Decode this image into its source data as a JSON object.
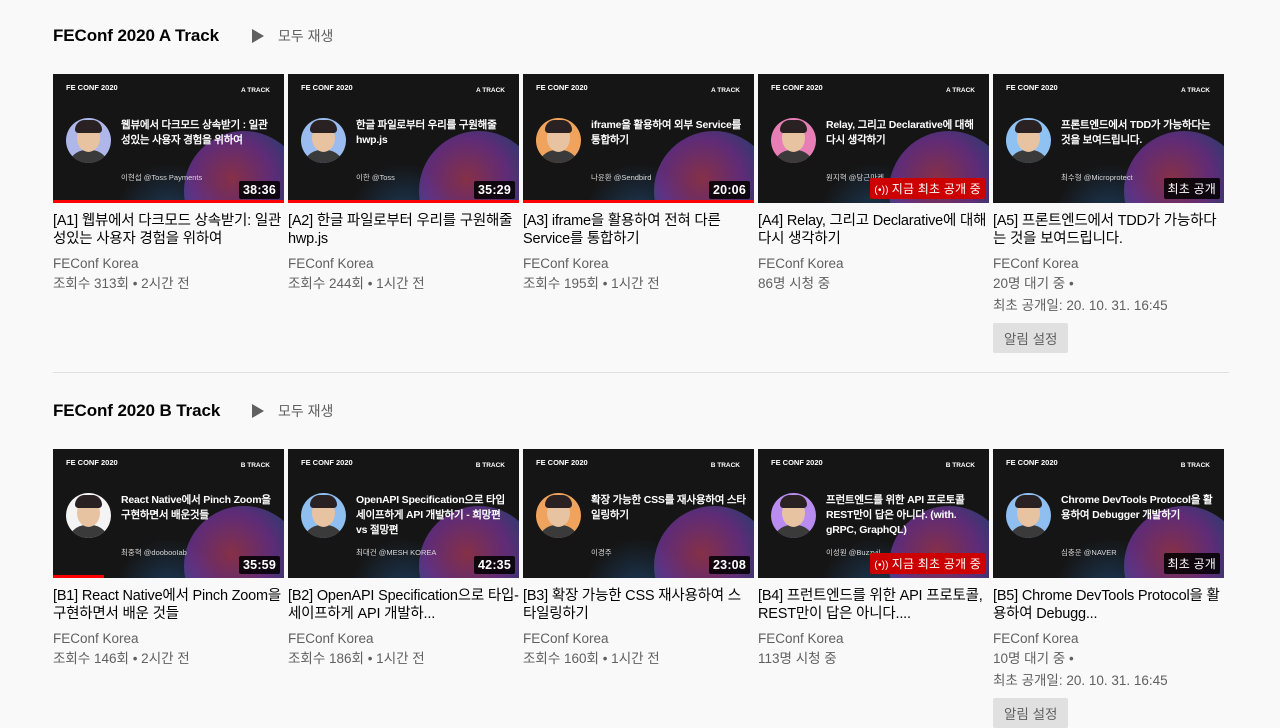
{
  "shelves": [
    {
      "title": "FEConf 2020 A Track",
      "play_all": "모두 재생",
      "videos": [
        {
          "thumb_logo": "FE CONF 2020",
          "thumb_track": "A TRACK",
          "thumb_title": "웹뷰에서 다크모드 상속받기 : 일관성있는 사용자 경험을 위하여",
          "thumb_speaker": "이현섭 @Toss Payments",
          "badge": "38:36",
          "badge_type": "duration",
          "progress": 1.0,
          "avatar_color": "#aeb6ea",
          "title": "[A1] 웹뷰에서 다크모드 상속받기: 일관성있는 사용자 경험을 위하여",
          "channel": "FEConf Korea",
          "meta1": "조회수 313회 • 2시간 전",
          "meta2": "",
          "notify": ""
        },
        {
          "thumb_logo": "FE CONF 2020",
          "thumb_track": "A TRACK",
          "thumb_title": "한글 파일로부터 우리를 구원해줄 hwp.js",
          "thumb_speaker": "이한 @Toss",
          "badge": "35:29",
          "badge_type": "duration",
          "progress": 1.0,
          "avatar_color": "#9bbcf0",
          "title": "[A2] 한글 파일로부터 우리를 구원해줄 hwp.js",
          "channel": "FEConf Korea",
          "meta1": "조회수 244회 • 1시간 전",
          "meta2": "",
          "notify": ""
        },
        {
          "thumb_logo": "FE CONF 2020",
          "thumb_track": "A TRACK",
          "thumb_title": "iframe을 활용하여 외부 Service를 통합하기",
          "thumb_speaker": "나윤환 @Sendbird",
          "badge": "20:06",
          "badge_type": "duration",
          "progress": 1.0,
          "avatar_color": "#f0a35c",
          "title": "[A3] iframe을 활용하여 전혀 다른 Service를 통합하기",
          "channel": "FEConf Korea",
          "meta1": "조회수 195회 • 1시간 전",
          "meta2": "",
          "notify": ""
        },
        {
          "thumb_logo": "FE CONF 2020",
          "thumb_track": "A TRACK",
          "thumb_title": "Relay, 그리고 Declarative에 대해 다시 생각하기",
          "thumb_speaker": "원지혁 @당근마켓",
          "badge": "지금 최초 공개 중",
          "badge_type": "live",
          "progress": 0.0,
          "avatar_color": "#e77fb6",
          "title": "[A4] Relay, 그리고 Declarative에 대해 다시 생각하기",
          "channel": "FEConf Korea",
          "meta1": "86명 시청 중",
          "meta2": "",
          "notify": ""
        },
        {
          "thumb_logo": "FE CONF 2020",
          "thumb_track": "A TRACK",
          "thumb_title": "프론트엔드에서 TDD가 가능하다는 것을 보여드립니다.",
          "thumb_speaker": "최수형 @Microprotect",
          "badge": "최초 공개",
          "badge_type": "premiere",
          "progress": 0.0,
          "avatar_color": "#8fc2f3",
          "title": "[A5] 프론트엔드에서 TDD가 가능하다는 것을 보여드립니다.",
          "channel": "FEConf Korea",
          "meta1": "20명 대기 중 •",
          "meta2": "최초 공개일: 20. 10. 31. 16:45",
          "notify": "알림 설정"
        }
      ]
    },
    {
      "title": "FEConf 2020 B Track",
      "play_all": "모두 재생",
      "videos": [
        {
          "thumb_logo": "FE CONF 2020",
          "thumb_track": "B TRACK",
          "thumb_title": "React Native에서 Pinch Zoom을 구현하면서 배운것들",
          "thumb_speaker": "최중혁 @doobooIab",
          "badge": "35:59",
          "badge_type": "duration",
          "progress": 0.22,
          "avatar_color": "#f4f4f4",
          "title": "[B1] React Native에서 Pinch Zoom을 구현하면서 배운 것들",
          "channel": "FEConf Korea",
          "meta1": "조회수 146회 • 2시간 전",
          "meta2": "",
          "notify": ""
        },
        {
          "thumb_logo": "FE CONF 2020",
          "thumb_track": "B TRACK",
          "thumb_title": "OpenAPI Specification으로 타입 세이프하게 API 개발하기 - 희망편 vs 절망편",
          "thumb_speaker": "최대건 @MESH KOREA",
          "badge": "42:35",
          "badge_type": "duration",
          "progress": 0.0,
          "avatar_color": "#8fbef0",
          "title": "[B2] OpenAPI Specification으로 타입-세이프하게 API 개발하...",
          "channel": "FEConf Korea",
          "meta1": "조회수 186회 • 1시간 전",
          "meta2": "",
          "notify": ""
        },
        {
          "thumb_logo": "FE CONF 2020",
          "thumb_track": "B TRACK",
          "thumb_title": "확장 가능한 CSS를 재사용하여 스타일링하기",
          "thumb_speaker": "이경주",
          "badge": "23:08",
          "badge_type": "duration",
          "progress": 0.0,
          "avatar_color": "#f0a35c",
          "title": "[B3] 확장 가능한 CSS 재사용하여 스타일링하기",
          "channel": "FEConf Korea",
          "meta1": "조회수 160회 • 1시간 전",
          "meta2": "",
          "notify": ""
        },
        {
          "thumb_logo": "FE CONF 2020",
          "thumb_track": "B TRACK",
          "thumb_title": "프런트엔드를 위한 API 프로토콜 REST만이 답은 아니다. (with. gRPC, GraphQL)",
          "thumb_speaker": "이성원 @Buzzvil",
          "badge": "지금 최초 공개 중",
          "badge_type": "live",
          "progress": 0.0,
          "avatar_color": "#b98cf0",
          "title": "[B4] 프런트엔드를 위한 API 프로토콜, REST만이 답은 아니다....",
          "channel": "FEConf Korea",
          "meta1": "113명 시청 중",
          "meta2": "",
          "notify": ""
        },
        {
          "thumb_logo": "FE CONF 2020",
          "thumb_track": "B TRACK",
          "thumb_title": "Chrome DevTools Protocol을 활용하여 Debugger 개발하기",
          "thumb_speaker": "심충운 @NAVER",
          "badge": "최초 공개",
          "badge_type": "premiere",
          "progress": 0.0,
          "avatar_color": "#8fbef0",
          "title": "[B5] Chrome DevTools Protocol을 활용하여 Debugg...",
          "channel": "FEConf Korea",
          "meta1": "10명 대기 중 •",
          "meta2": "최초 공개일: 20. 10. 31. 16:45",
          "notify": "알림 설정"
        }
      ]
    }
  ]
}
